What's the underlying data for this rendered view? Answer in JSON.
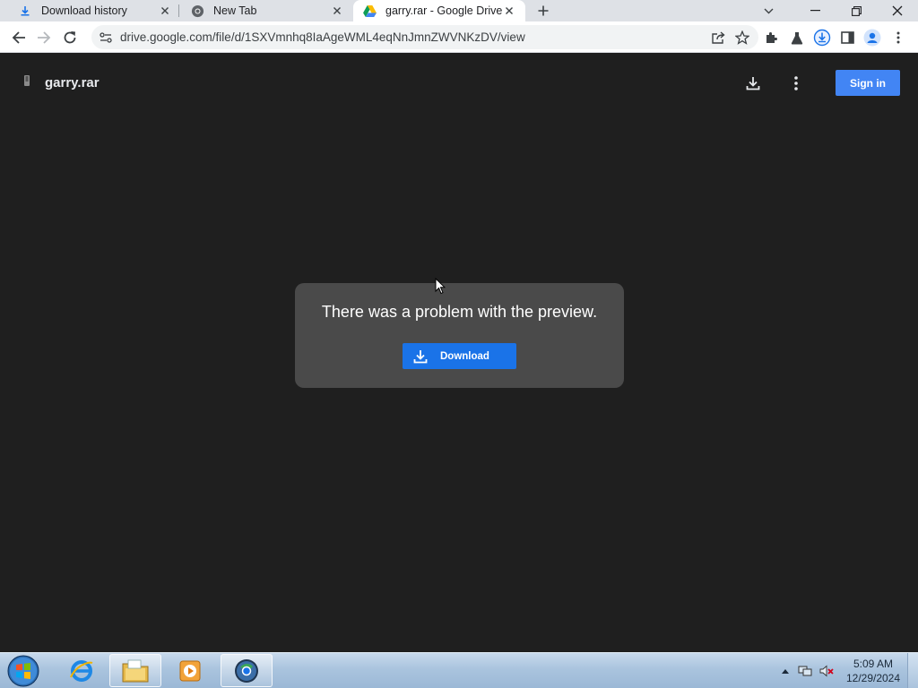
{
  "browser": {
    "tabs": [
      {
        "title": "Download history",
        "icon": "download-icon"
      },
      {
        "title": "New Tab",
        "icon": "chrome-icon"
      },
      {
        "title": "garry.rar - Google Drive",
        "icon": "google-drive-icon",
        "active": true
      }
    ],
    "url": "drive.google.com/file/d/1SXVmnhq8IaAgeWML4eqNnJmnZWVNKzDV/view"
  },
  "viewer": {
    "file_name": "garry.rar",
    "sign_in_label": "Sign in",
    "error_message": "There was a problem with the preview.",
    "download_label": "Download"
  },
  "taskbar": {
    "time": "5:09 AM",
    "date": "12/29/2024"
  },
  "colors": {
    "page_bg": "#1f1f1f",
    "dialog_bg": "#4a4a4a",
    "primary_blue": "#1a73e8",
    "signin_blue": "#4285f4"
  }
}
